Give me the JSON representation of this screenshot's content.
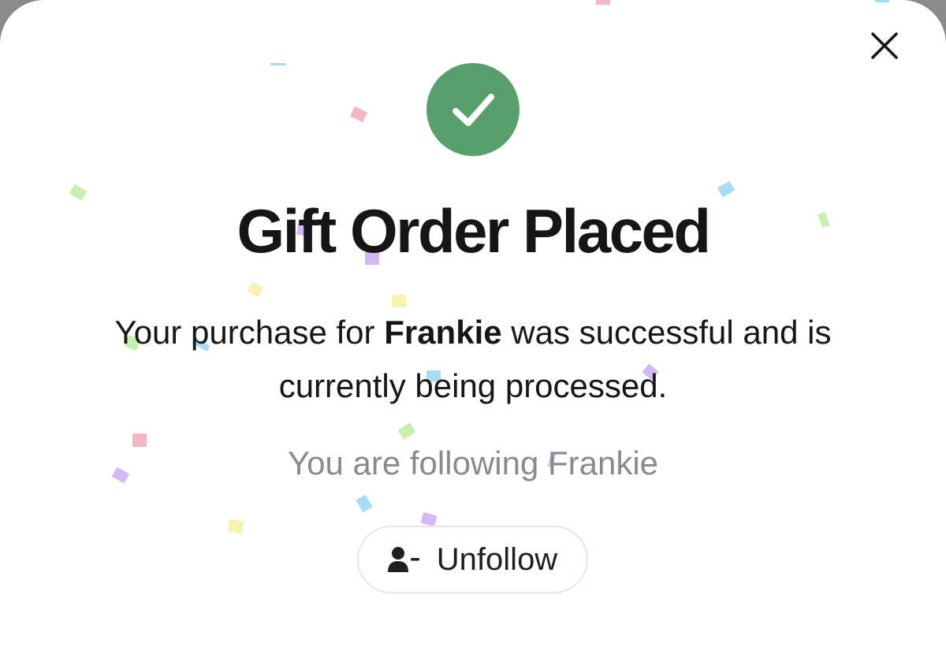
{
  "dialog": {
    "title": "Gift Order Placed",
    "message_prefix": "Your purchase for ",
    "recipient_name": "Frankie",
    "message_suffix": " was successful and is currently being processed.",
    "following_status": "You are following Frankie",
    "unfollow_label": "Unfollow"
  },
  "icons": {
    "close": "close-icon",
    "success": "checkmark-icon",
    "unfollow": "user-minus-icon"
  },
  "colors": {
    "success_green": "#589f6b",
    "title_text": "#161616",
    "muted_text": "#8a8a8a",
    "button_border": "#e6e6e6"
  }
}
